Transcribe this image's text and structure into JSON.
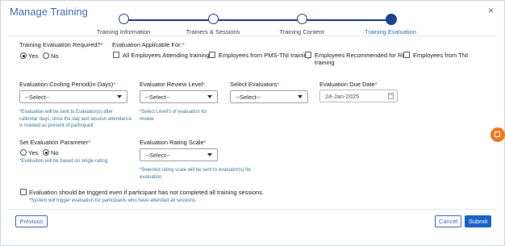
{
  "header": {
    "title": "Manage Training",
    "close": "×"
  },
  "stepper": {
    "steps": [
      {
        "label": "Training Information"
      },
      {
        "label": "Trainers & Sessions"
      },
      {
        "label": "Training Content"
      },
      {
        "label": "Training Evaluation"
      }
    ],
    "active_index": 3
  },
  "eval_required": {
    "label": "Training Evaluation Required?",
    "required_mark": "*",
    "yes": "Yes",
    "no": "No",
    "selected": "Yes"
  },
  "applicable_for": {
    "label": "Evaluation Applicable For:",
    "required_mark": "*",
    "options": [
      "All Employees Attending training",
      "Employees from PMS-TNI training",
      "Employees Recommended for Re-",
      "training",
      "Employees from TNI"
    ]
  },
  "cooling_period": {
    "label": "Evaluation Cooling Period(in Days)",
    "required_mark": "*",
    "value": "--Select--",
    "note_lines": [
      "*Evaluation will be sent to Evaluator(s) after",
      "calendar days, once the day last session attendance",
      "is marked as present of participant"
    ]
  },
  "reviewer_level": {
    "label": "Evaluator Review Level",
    "required_mark": "*",
    "value": "--Select--",
    "note_lines": [
      "*Select Level's of evaluation for",
      "review."
    ]
  },
  "select_evaluators": {
    "label": "Select Evaluators",
    "required_mark": "*",
    "value": "--Select--"
  },
  "due_date": {
    "label": "Evaluation Due Date",
    "required_mark": "*",
    "value": "24-Jan-2025"
  },
  "parameter": {
    "label": "Set Evaluation Parameter",
    "required_mark": "*",
    "yes": "Yes",
    "no": "No",
    "selected": "No",
    "note": "*Evaluation will be based on single rating."
  },
  "rating_scale": {
    "label": "Evaluation Rating Scale",
    "required_mark": "*",
    "value": "--Select--",
    "note_lines": [
      "*Selected rating scale will be sent to evaluator(s) for",
      "evaluation."
    ]
  },
  "trigger": {
    "label": "Evaluation should be triggerd even if participant has not completed all training sessions.",
    "note": "*System will trigger evaluation for participants who have attended all sessions."
  },
  "footer": {
    "previous": "Previous",
    "cancel": "Cancel",
    "submit": "Submit"
  },
  "colors": {
    "accent": "#3b6fb6",
    "stepper": "#1f3f8f",
    "primary_button": "#1b63c9",
    "required": "#d9342b",
    "note": "#3a7a9a",
    "fab": "#f07a20"
  }
}
